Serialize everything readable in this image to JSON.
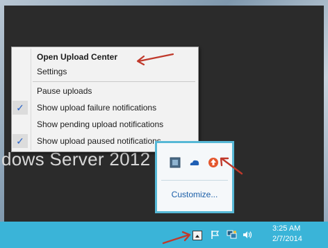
{
  "watermark": "dows Server 2012",
  "context_menu": {
    "items": [
      {
        "label": "Open Upload Center",
        "bold": true,
        "checked": false
      },
      {
        "label": "Settings",
        "bold": false,
        "checked": false
      },
      {
        "label": "Pause uploads",
        "bold": false,
        "checked": false
      },
      {
        "label": "Show upload failure notifications",
        "bold": false,
        "checked": true
      },
      {
        "label": "Show pending upload notifications",
        "bold": false,
        "checked": false
      },
      {
        "label": "Show upload paused notifications",
        "bold": false,
        "checked": true
      }
    ],
    "check_glyph": "✓"
  },
  "tray_popup": {
    "customize_label": "Customize...",
    "icons": [
      "generic-app-icon",
      "onedrive-cloud-icon",
      "upload-center-icon"
    ]
  },
  "taskbar": {
    "clock": {
      "time": "3:25 AM",
      "date": "2/7/2014"
    },
    "icons": [
      "show-hidden-icons-icon",
      "action-center-flag-icon",
      "network-icon",
      "volume-icon"
    ]
  },
  "colors": {
    "taskbar": "#3ab4d8",
    "desktop": "#2b2b2b",
    "annotation_arrow": "#c0392b",
    "popup_border": "#56b8d6",
    "check": "#2a64c8"
  }
}
